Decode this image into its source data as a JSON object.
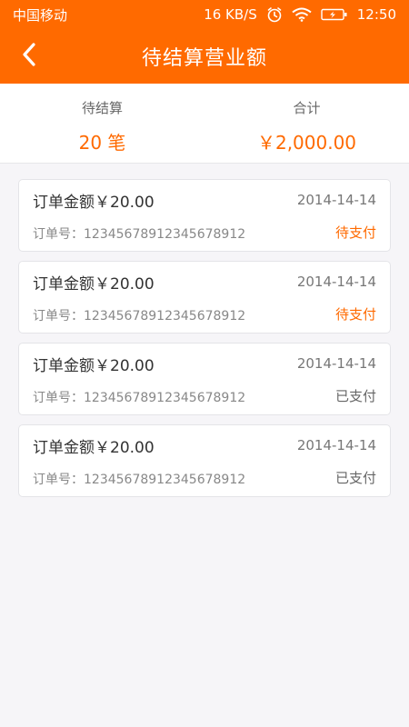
{
  "status_bar": {
    "carrier": "中国移动",
    "speed": "16 KB/S",
    "time": "12:50",
    "icons": [
      "alarm-icon",
      "wifi-icon",
      "battery-icon"
    ]
  },
  "header": {
    "title": "待结算营业额",
    "back_icon": "chevron-left-icon"
  },
  "summary": {
    "pending_label": "待结算",
    "pending_value": "20 笔",
    "total_label": "合计",
    "total_value": "￥2,000.00"
  },
  "orders": [
    {
      "amount": "订单金额￥20.00",
      "date": "2014-14-14",
      "order_no": "订单号：12345678912345678912",
      "status": "待支付",
      "status_type": "pending"
    },
    {
      "amount": "订单金额￥20.00",
      "date": "2014-14-14",
      "order_no": "订单号：12345678912345678912",
      "status": "待支付",
      "status_type": "pending"
    },
    {
      "amount": "订单金额￥20.00",
      "date": "2014-14-14",
      "order_no": "订单号：12345678912345678912",
      "status": "已支付",
      "status_type": "paid"
    },
    {
      "amount": "订单金额￥20.00",
      "date": "2014-14-14",
      "order_no": "订单号：12345678912345678912",
      "status": "已支付",
      "status_type": "paid"
    }
  ],
  "colors": {
    "accent": "#ff6a00",
    "background": "#f6f5f8",
    "paid_text": "#666666"
  }
}
